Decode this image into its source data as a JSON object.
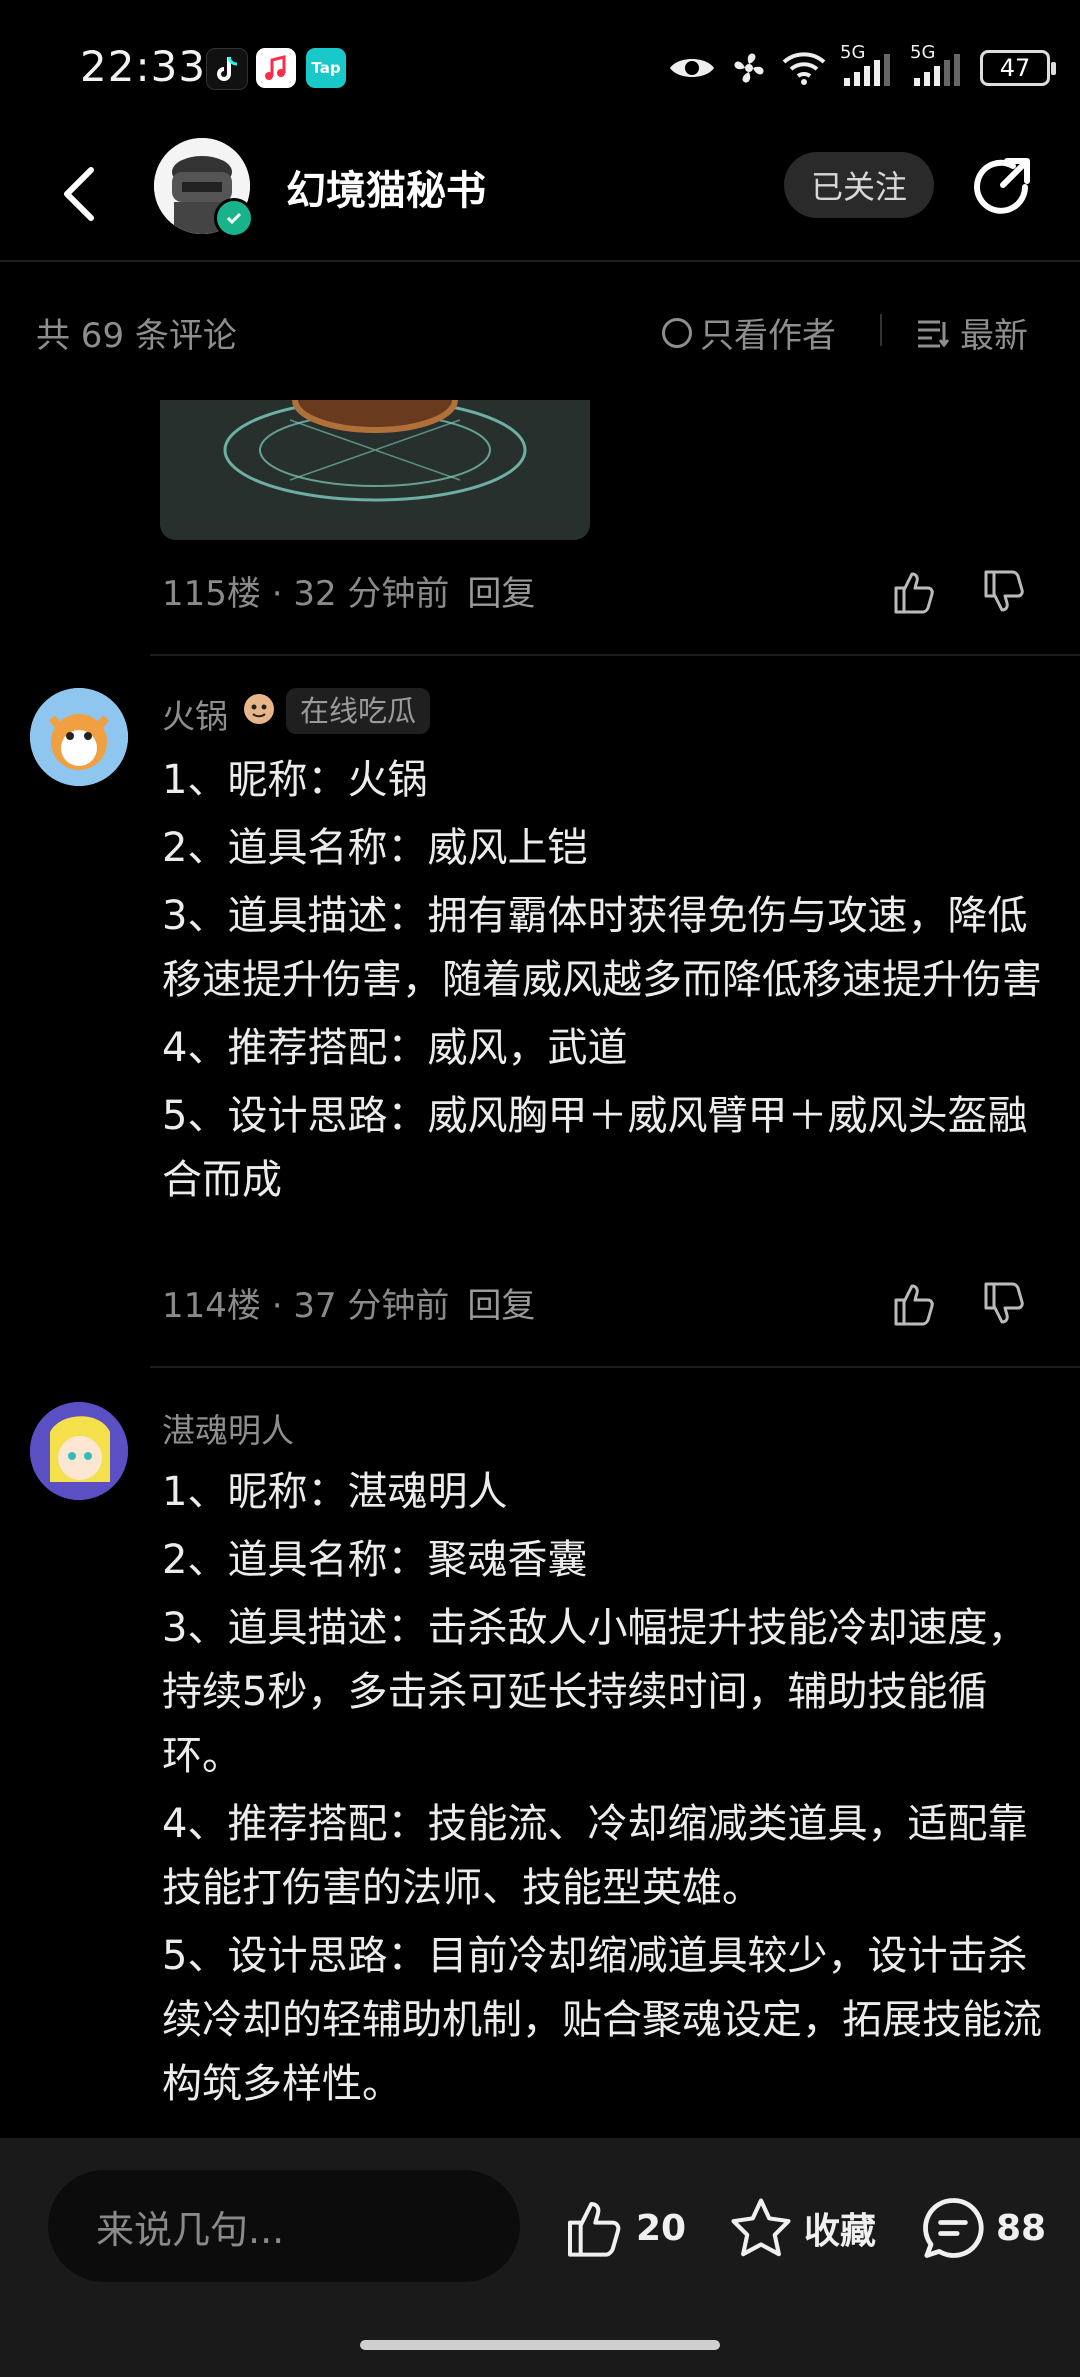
{
  "status_bar": {
    "time": "22:33",
    "network_1": "5G",
    "network_2": "5G",
    "battery": "47"
  },
  "header": {
    "author_name": "幻境猫秘书",
    "follow_label": "已关注"
  },
  "comments_bar": {
    "count_text": "共 69 条评论",
    "author_only_label": "只看作者",
    "sort_label": "最新"
  },
  "comments": [
    {
      "floor": "115楼",
      "time": "32 分钟前",
      "reply": "回复"
    },
    {
      "user": "火锅",
      "badge": "在线吃瓜",
      "lines": [
        "1、昵称：火锅",
        "2、道具名称：威风上铠",
        "3、道具描述：拥有霸体时获得免伤与攻速，降低移速提升伤害，随着威风越多而降低移速提升伤害",
        "4、推荐搭配：威风，武道",
        "5、设计思路：威风胸甲＋威风臂甲＋威风头盔融合而成"
      ],
      "floor": "114楼",
      "time": "37 分钟前",
      "reply": "回复"
    },
    {
      "user": "湛魂明人",
      "lines": [
        "1、昵称：湛魂明人",
        "2、道具名称：聚魂香囊",
        "3、道具描述：击杀敌人小幅提升技能冷却速度，持续5秒，多击杀可延长持续时间，辅助技能循环。",
        "4、推荐搭配：技能流、冷却缩减类道具，适配靠技能打伤害的法师、技能型英雄。",
        "5、设计思路：目前冷却缩减道具较少，设计击杀续冷却的轻辅助机制，贴合聚魂设定，拓展技能流构筑多样性。"
      ]
    }
  ],
  "bottom_bar": {
    "input_placeholder": "来说几句...",
    "like_count": "20",
    "favorite_label": "收藏",
    "comment_count": "88"
  }
}
